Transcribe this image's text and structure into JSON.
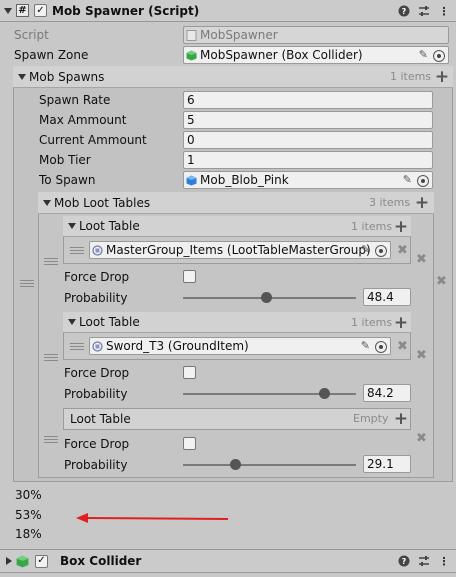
{
  "mob_spawner": {
    "title": "Mob Spawner (Script)",
    "enabled_check": "✓",
    "script_label": "Script",
    "script_value": "MobSpawner",
    "spawn_zone_label": "Spawn Zone",
    "spawn_zone_value": "MobSpawner (Box Collider)"
  },
  "mob_spawns": {
    "label": "Mob Spawns",
    "count": "1 items",
    "fields": [
      {
        "label": "Spawn Rate",
        "value": "6"
      },
      {
        "label": "Max Ammount",
        "value": "5"
      },
      {
        "label": "Current Ammount",
        "value": "0"
      },
      {
        "label": "Mob Tier",
        "value": "1"
      }
    ],
    "to_spawn_label": "To Spawn",
    "to_spawn_value": "Mob_Blob_Pink"
  },
  "mob_loot_tables": {
    "label": "Mob Loot Tables",
    "count": "3 items",
    "entries": [
      {
        "loot_label": "Loot Table",
        "loot_count": "1 items",
        "item": "MasterGroup_Items (LootTableMasterGroup)",
        "force_drop_label": "Force Drop",
        "probability_label": "Probability",
        "probability": "48.4",
        "slider_fraction": 0.484
      },
      {
        "loot_label": "Loot Table",
        "loot_count": "1 items",
        "item": "Sword_T3 (GroundItem)",
        "force_drop_label": "Force Drop",
        "probability_label": "Probability",
        "probability": "84.2",
        "slider_fraction": 0.842
      },
      {
        "loot_label": "Loot Table",
        "loot_count": "Empty",
        "force_drop_label": "Force Drop",
        "probability_label": "Probability",
        "probability": "29.1",
        "slider_fraction": 0.291
      }
    ]
  },
  "percentages": [
    "30%",
    "53%",
    "18%"
  ],
  "box_collider": {
    "title": "Box Collider",
    "enabled_check": "✓"
  },
  "colors": {
    "annotation_arrow": "#e02020",
    "box_collider_icon": "#3aa64a",
    "prefab_icon": "#2f7fd6"
  }
}
